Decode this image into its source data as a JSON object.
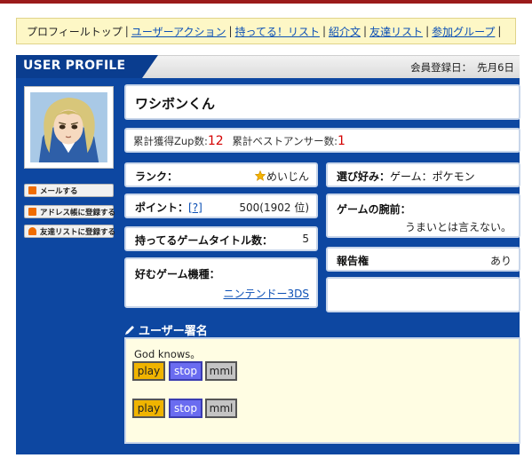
{
  "nav": {
    "current": "プロフィールトップ",
    "links": [
      "ユーザーアクション",
      "持ってる！リスト",
      "紹介文",
      "友達リスト",
      "参加グループ"
    ],
    "separator": "|"
  },
  "header": {
    "title": "USER PROFILE",
    "member_label": "会員登録日：",
    "member_value": "先月6日"
  },
  "sidebar": {
    "buttons": [
      {
        "label": "メールする",
        "icon": "mail-icon"
      },
      {
        "label": "アドレス帳に登録する",
        "icon": "address-book-icon"
      },
      {
        "label": "友達リストに登録する",
        "icon": "user-icon"
      }
    ]
  },
  "profile": {
    "name": "ワシボンくん",
    "zup_label": "累計獲得Zup数:",
    "zup_value": "12",
    "best_label": "累計ベストアンサー数:",
    "best_value": "1",
    "rank_label": "ランク：",
    "rank_value": "めいじん",
    "point_label": "ポイント：",
    "point_help": "[?]",
    "point_value": "500(1902 位)",
    "titles_label": "持ってるゲームタイトル数：",
    "titles_value": "5",
    "console_label": "好むゲーム機種：",
    "console_value": "ニンテンドー3DS",
    "pref_label": "選び好み：",
    "pref_value": "ゲーム：ポケモン",
    "skill_label": "ゲームの腕前：",
    "skill_value": "うまいとは言えない。",
    "report_label": "報告権",
    "report_value": "あり"
  },
  "signature": {
    "heading": "ユーザー署名",
    "text": "God knows。",
    "play_label": "play",
    "stop_label": "stop",
    "mml_label": "mml"
  },
  "colors": {
    "panel": "#0d47a1",
    "nav_bg": "#fdf7c6",
    "link": "#0b4fb5",
    "highlight": "#d40000",
    "play": "#f0b400",
    "stop": "#6a6cf0",
    "mml": "#c4c4c4"
  }
}
